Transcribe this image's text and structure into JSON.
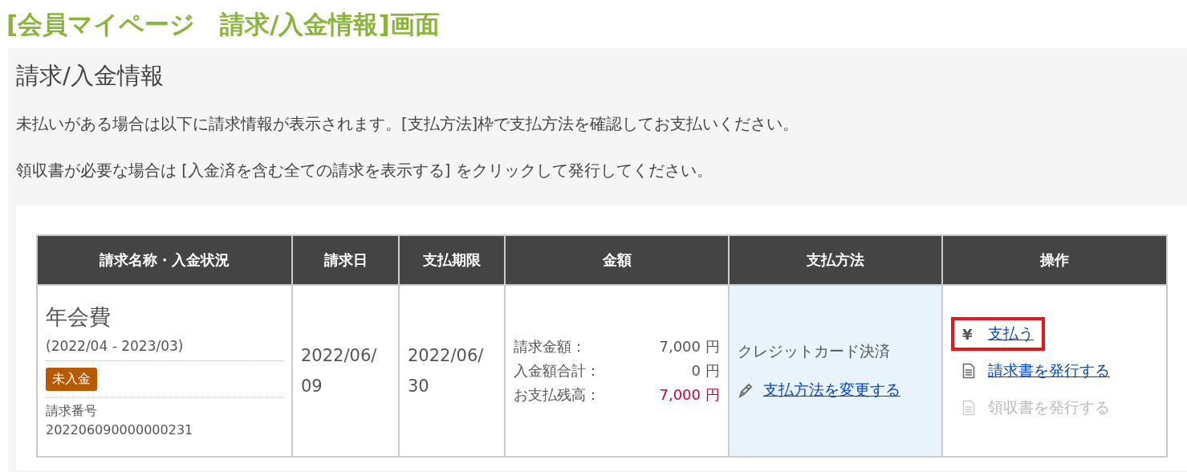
{
  "page_title": "[会員マイページ　請求/入金情報]画面",
  "panel": {
    "heading": "請求/入金情報",
    "notes": [
      "未払いがある場合は以下に請求情報が表示されます。[支払方法]枠で支払方法を確認してお支払いください。",
      "領収書が必要な場合は [入金済を含む全ての請求を表示する] をクリックして発行してください。"
    ]
  },
  "table": {
    "columns": [
      "請求名称・入金状況",
      "請求日",
      "支払期限",
      "金額",
      "支払方法",
      "操作"
    ],
    "rows": [
      {
        "name": "年会費",
        "period": "(2022/04 - 2023/03)",
        "status": "未入金",
        "number_label": "請求番号",
        "number": "202206090000000231",
        "billing_date": "2022/06/09",
        "due_date": "2022/06/30",
        "amounts": [
          {
            "label": "請求金額：",
            "value": "7,000",
            "unit": "円",
            "emphasis": false
          },
          {
            "label": "入金額合計：",
            "value": "0",
            "unit": "円",
            "emphasis": false
          },
          {
            "label": "お支払残高：",
            "value": "7,000",
            "unit": "円",
            "emphasis": true
          }
        ],
        "payment_method": "クレジットカード決済",
        "change_link": "支払方法を変更する",
        "actions": [
          {
            "kind": "pay",
            "icon": "¥",
            "label": "支払う",
            "disabled": false,
            "highlighted": true
          },
          {
            "kind": "document",
            "label": "請求書を発行する",
            "disabled": false,
            "highlighted": false
          },
          {
            "kind": "document",
            "label": "領収書を発行する",
            "disabled": true,
            "highlighted": false
          }
        ]
      }
    ]
  }
}
